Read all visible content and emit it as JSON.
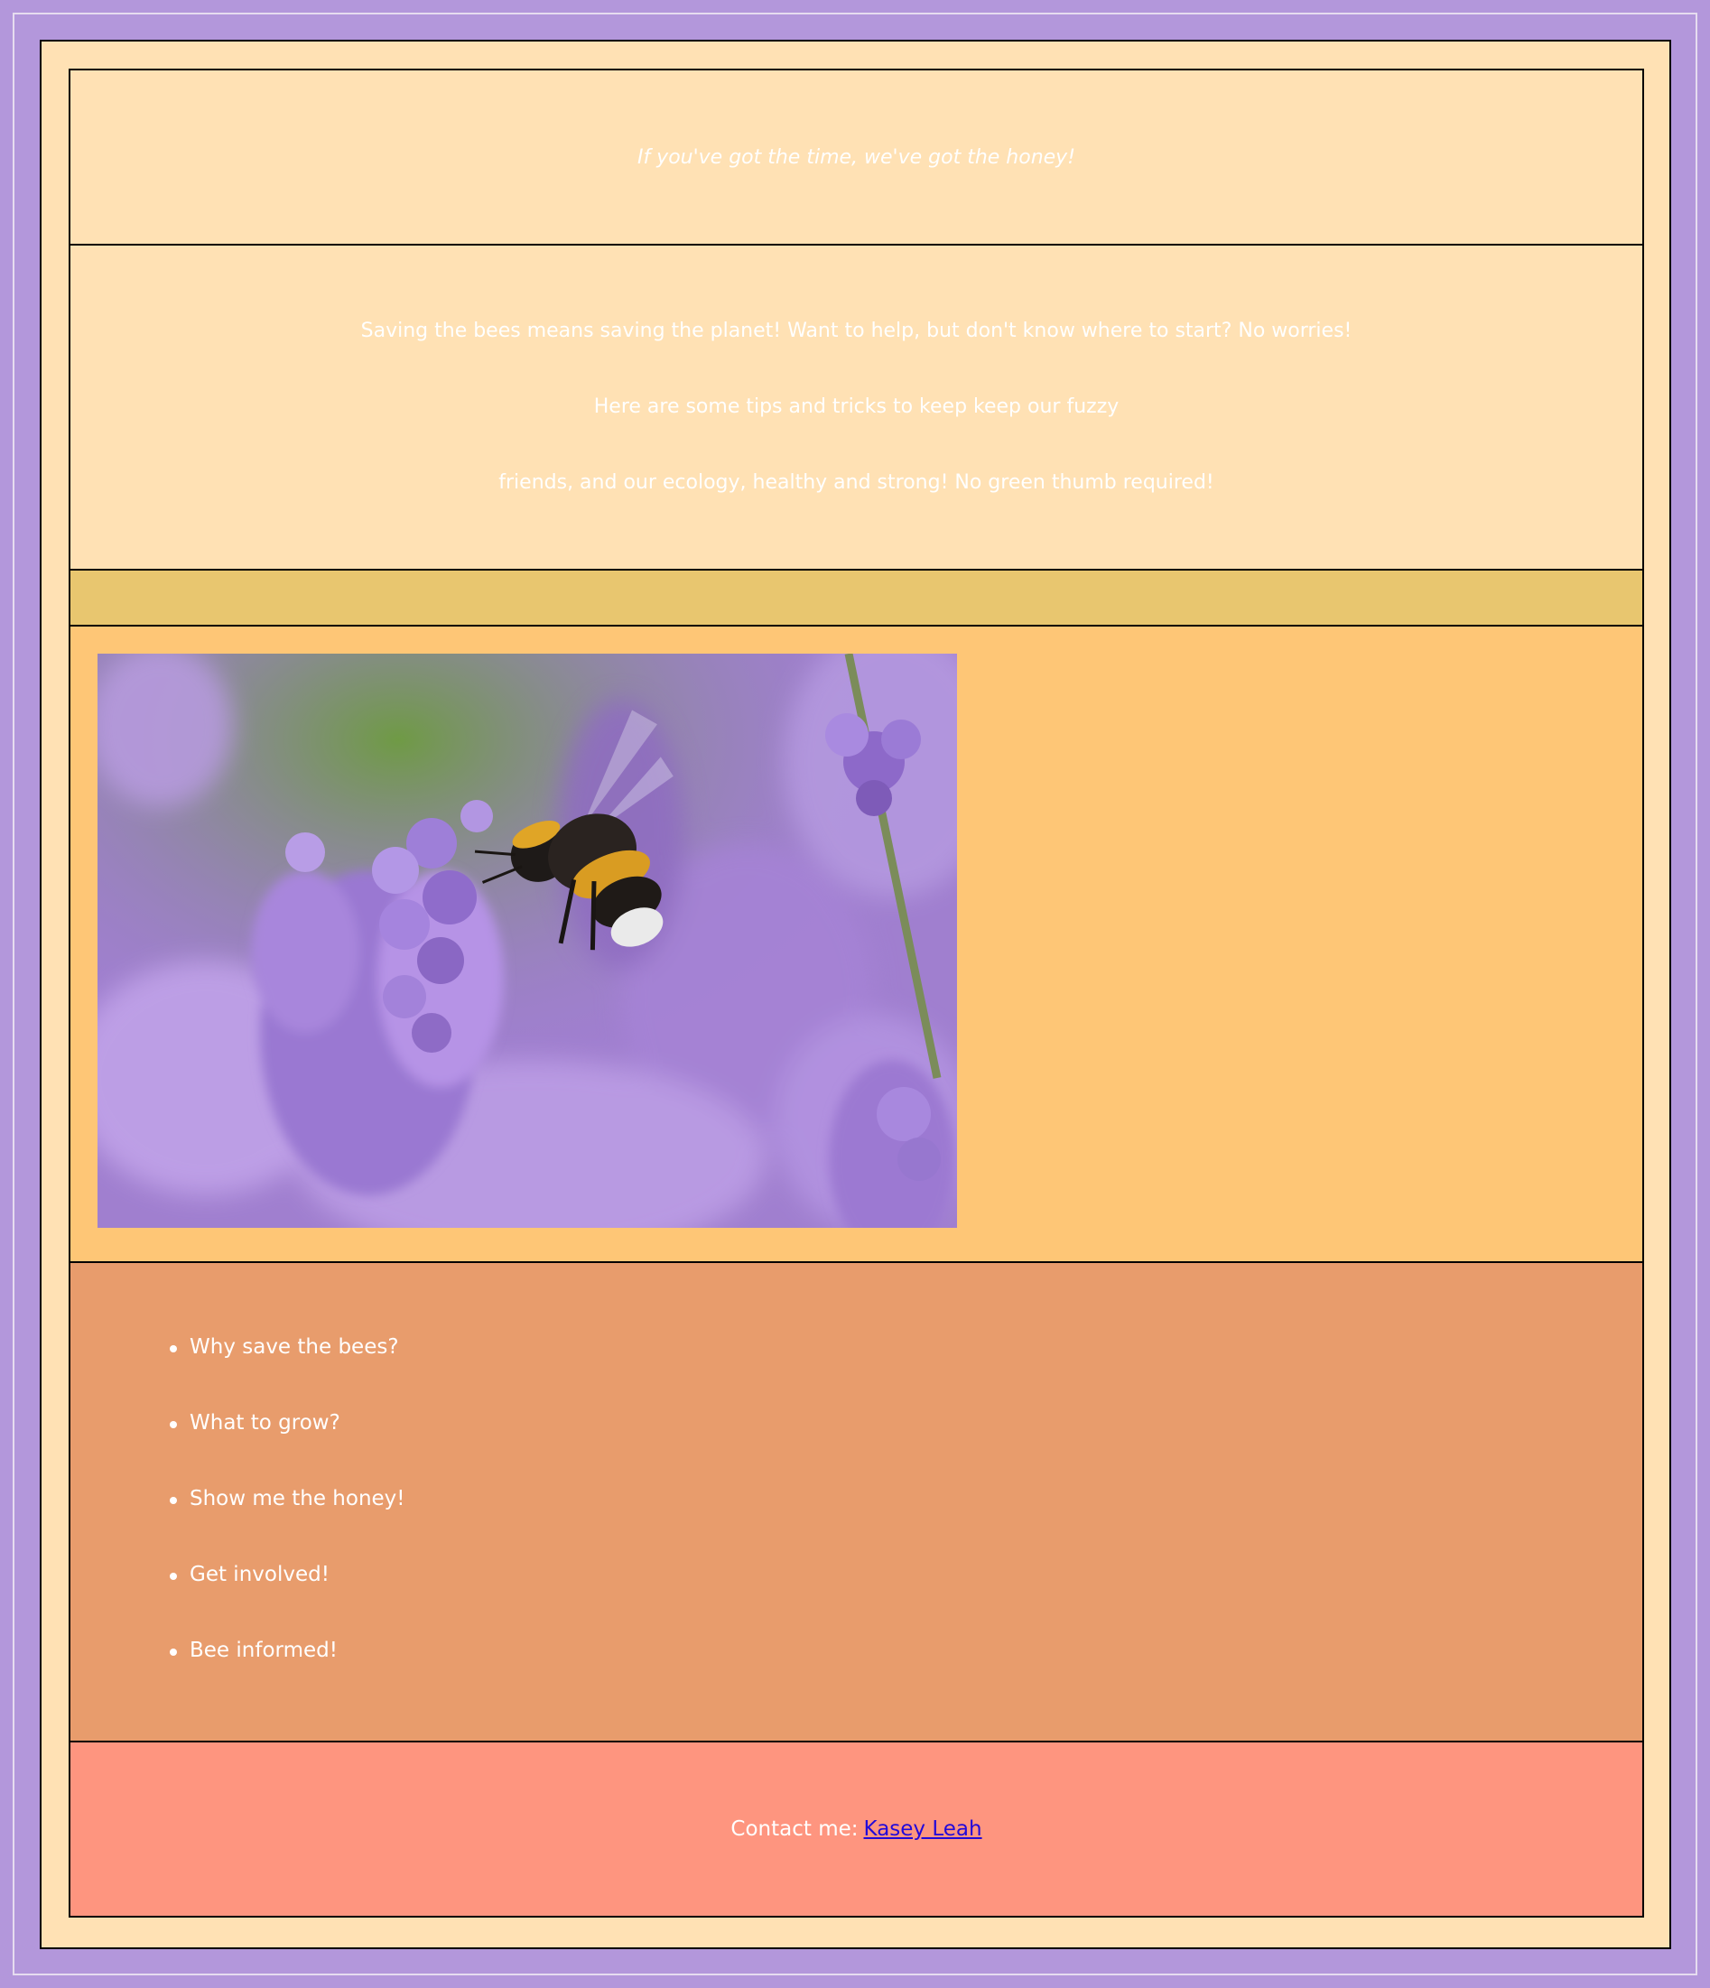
{
  "colors": {
    "page_background": "#b397db",
    "content_background": "#ffe1b4",
    "strip": "#e8c66f",
    "hero_background": "#fec676",
    "nav_background": "#e89c6c",
    "footer_background": "#fe957f",
    "text": "#ffffff",
    "link": "#2309d9"
  },
  "tagline": "If you've got the time, we've got the honey!",
  "intro": {
    "line1": "Saving the bees means saving the planet! Want to help, but don't know where to start? No worries!",
    "line2": "Here are some tips and tricks to keep keep our fuzzy",
    "line3": "friends, and our ecology, healthy and strong! No green thumb required!"
  },
  "hero": {
    "image_subject": "bumblebee-on-lavender"
  },
  "nav": {
    "items": [
      {
        "label": "Why save the bees?"
      },
      {
        "label": "What to grow?"
      },
      {
        "label": "Show me the honey!"
      },
      {
        "label": "Get involved!"
      },
      {
        "label": "Bee informed!"
      }
    ]
  },
  "footer": {
    "contact_prefix": "Contact me:",
    "contact_link_label": "Kasey Leah"
  }
}
